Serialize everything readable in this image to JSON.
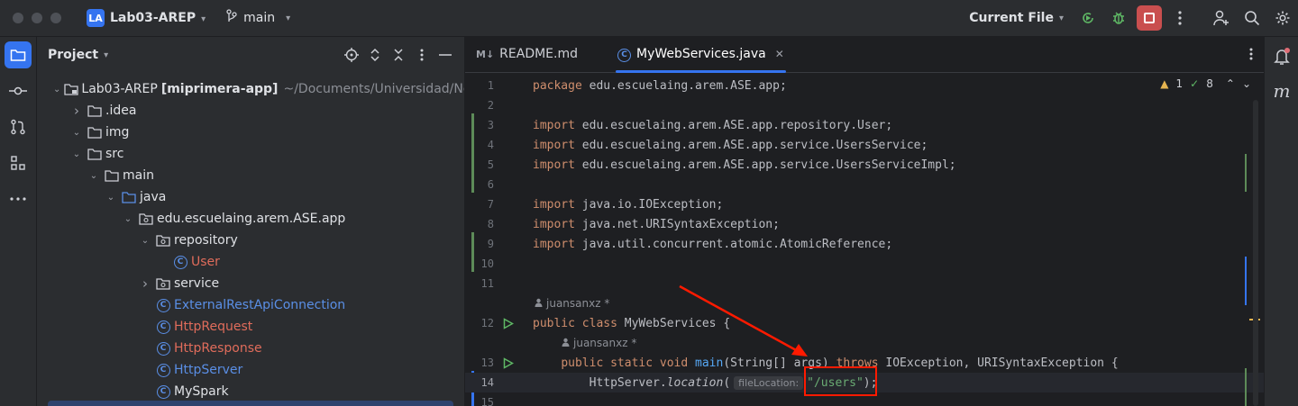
{
  "titlebar": {
    "project_badge": "LA",
    "project_name": "Lab03-AREP",
    "branch": "main",
    "run_config": "Current File",
    "icons": [
      "branch-icon",
      "run-coverage-icon",
      "debug-icon",
      "stop-icon",
      "more-vert-icon",
      "add-user-icon",
      "search-icon",
      "gear-icon"
    ]
  },
  "project_panel": {
    "title": "Project",
    "tree": [
      {
        "depth": 0,
        "arrow": "down",
        "icon": "module",
        "label": "Lab03-AREP",
        "bold_suffix": "[miprimera-app]",
        "path": "~/Documents/Universidad/Noveno Se"
      },
      {
        "depth": 1,
        "arrow": "right",
        "icon": "folder",
        "label": ".idea"
      },
      {
        "depth": 1,
        "arrow": "down",
        "icon": "folder",
        "label": "img"
      },
      {
        "depth": 1,
        "arrow": "down",
        "icon": "folder",
        "label": "src"
      },
      {
        "depth": 2,
        "arrow": "down",
        "icon": "folder",
        "label": "main"
      },
      {
        "depth": 3,
        "arrow": "down",
        "icon": "folder-blue",
        "label": "java"
      },
      {
        "depth": 4,
        "arrow": "down",
        "icon": "package",
        "label": "edu.escuelaing.arem.ASE.app"
      },
      {
        "depth": 5,
        "arrow": "down",
        "icon": "package",
        "label": "repository"
      },
      {
        "depth": 6,
        "arrow": "",
        "icon": "class",
        "label": "User",
        "color": "red"
      },
      {
        "depth": 5,
        "arrow": "right",
        "icon": "package",
        "label": "service"
      },
      {
        "depth": 5,
        "arrow": "",
        "icon": "class",
        "label": "ExternalRestApiConnection",
        "color": "blue"
      },
      {
        "depth": 5,
        "arrow": "",
        "icon": "class",
        "label": "HttpRequest",
        "color": "red"
      },
      {
        "depth": 5,
        "arrow": "",
        "icon": "class",
        "label": "HttpResponse",
        "color": "red"
      },
      {
        "depth": 5,
        "arrow": "",
        "icon": "class",
        "label": "HttpServer",
        "color": "blue"
      },
      {
        "depth": 5,
        "arrow": "",
        "icon": "class",
        "label": "MySpark",
        "color": ""
      }
    ]
  },
  "tabs": [
    {
      "icon": "M↓",
      "label": "README.md",
      "active": false
    },
    {
      "icon": "C",
      "label": "MyWebServices.java",
      "active": true
    }
  ],
  "inspections": {
    "warnings": "1",
    "ok": "8"
  },
  "code": {
    "lines": [
      {
        "n": "1",
        "html": "<span class=\"kw\">package</span> edu.escuelaing.arem.ASE.app;"
      },
      {
        "n": "2",
        "html": ""
      },
      {
        "n": "3",
        "html": "<span class=\"kw\">import</span> edu.escuelaing.arem.ASE.app.repository.User;"
      },
      {
        "n": "4",
        "html": "<span class=\"kw\">import</span> edu.escuelaing.arem.ASE.app.service.UsersService;"
      },
      {
        "n": "5",
        "html": "<span class=\"kw\">import</span> edu.escuelaing.arem.ASE.app.service.UsersServiceImpl;"
      },
      {
        "n": "6",
        "html": ""
      },
      {
        "n": "7",
        "html": "<span class=\"kw\">import</span> java.io.IOException;"
      },
      {
        "n": "8",
        "html": "<span class=\"kw\">import</span> java.net.URISyntaxException;"
      },
      {
        "n": "9",
        "html": "<span class=\"kw\">import</span> java.util.concurrent.atomic.AtomicReference;"
      },
      {
        "n": "10",
        "html": ""
      },
      {
        "n": "11",
        "html": ""
      },
      {
        "n": "12",
        "html": "<span class=\"kw\">public class</span> MyWebServices {"
      },
      {
        "n": "13",
        "html": "    <span class=\"kw\">public static void</span> <span class=\"fn\">main</span>(String[] args) <span class=\"kw\">throws</span> IOException, URISyntaxException {"
      },
      {
        "n": "14",
        "html": "        HttpServer.<span class=\"it\">location</span>(<span class=\"hint\">fileLocation:</span><span class=\"st\">\"/users\"</span>);"
      },
      {
        "n": "15",
        "html": ""
      }
    ],
    "author_1": "juansanxz *",
    "author_2": "juansanxz *"
  },
  "right_strip": {
    "icons": [
      "notifications-icon",
      "m-plugin-icon"
    ],
    "m_label": "m"
  },
  "colors": {
    "accent": "#3574f0",
    "annotation": "#ff1a00",
    "keyword": "#cf8e6d",
    "string": "#6aab73",
    "method": "#56a8f5"
  }
}
